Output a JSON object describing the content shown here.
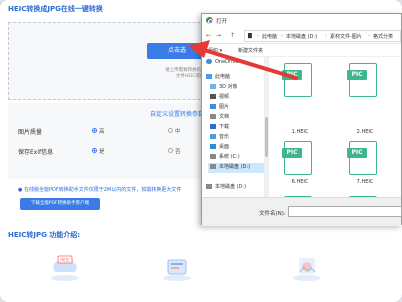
{
  "page": {
    "title": "HEIC转换成JPG在线一键转换",
    "upload_button": "点击选",
    "upload_hint_1": "请上传需要转换的HEIC文件",
    "upload_hint_2": "文件HEIC或HEIF",
    "settings_title": "自定义设置转换参数",
    "quality_label": "图片质量",
    "quality_options": [
      "高",
      "中"
    ],
    "exif_label": "保存Exif信息",
    "exif_options": [
      "是",
      "否"
    ],
    "promo_text": "在线版全能PDF转换助手文件仅限于2M以内的文件，如需转换更大文件",
    "promo_button": "下载全能PDF转换助手客户端",
    "intro_title": "HEIC转JPG 功能介绍:",
    "intro_badge": "HEIC"
  },
  "dialog": {
    "title": "打开",
    "nav_back": "←",
    "nav_forward": "→",
    "nav_up": "↑",
    "breadcrumb": [
      "此电脑",
      "本地磁盘 (D:)",
      "素材文件-图片",
      "格式分类"
    ],
    "toolbar": {
      "organize": "组织 ▾",
      "new_folder": "新建文件夹"
    },
    "nav_items": [
      {
        "label": "OneDrive",
        "icon": "cloud-icon"
      },
      {
        "label": "此电脑",
        "icon": "computer-icon"
      },
      {
        "label": "3D 对象",
        "icon": "cube-icon"
      },
      {
        "label": "视频",
        "icon": "video-icon"
      },
      {
        "label": "图片",
        "icon": "image-icon"
      },
      {
        "label": "文档",
        "icon": "document-icon"
      },
      {
        "label": "下载",
        "icon": "download-icon"
      },
      {
        "label": "音乐",
        "icon": "music-icon"
      },
      {
        "label": "桌面",
        "icon": "desktop-icon"
      },
      {
        "label": "系统 (C:)",
        "icon": "drive-icon"
      },
      {
        "label": "本地磁盘 (D:)",
        "icon": "drive-icon",
        "selected": true
      },
      {
        "label": "本地磁盘 (D:)",
        "icon": "drive-icon"
      }
    ],
    "files": [
      {
        "name": "",
        "type": "PIC"
      },
      {
        "name": "",
        "type": "PIC"
      },
      {
        "name": "1.HEIC",
        "type": "PIC"
      },
      {
        "name": "2.HEIC",
        "type": "PIC"
      },
      {
        "name": "6.HEIC",
        "type": "PIC"
      },
      {
        "name": "7.HEIC",
        "type": "PIC"
      },
      {
        "name": "",
        "type": "PIC"
      },
      {
        "name": "",
        "type": "PIC"
      }
    ],
    "filename_label": "文件名(N):",
    "filename_value": ""
  },
  "colors": {
    "accent": "#3a7be8",
    "file_green": "#3fb68b",
    "arrow_red": "#e53935"
  }
}
